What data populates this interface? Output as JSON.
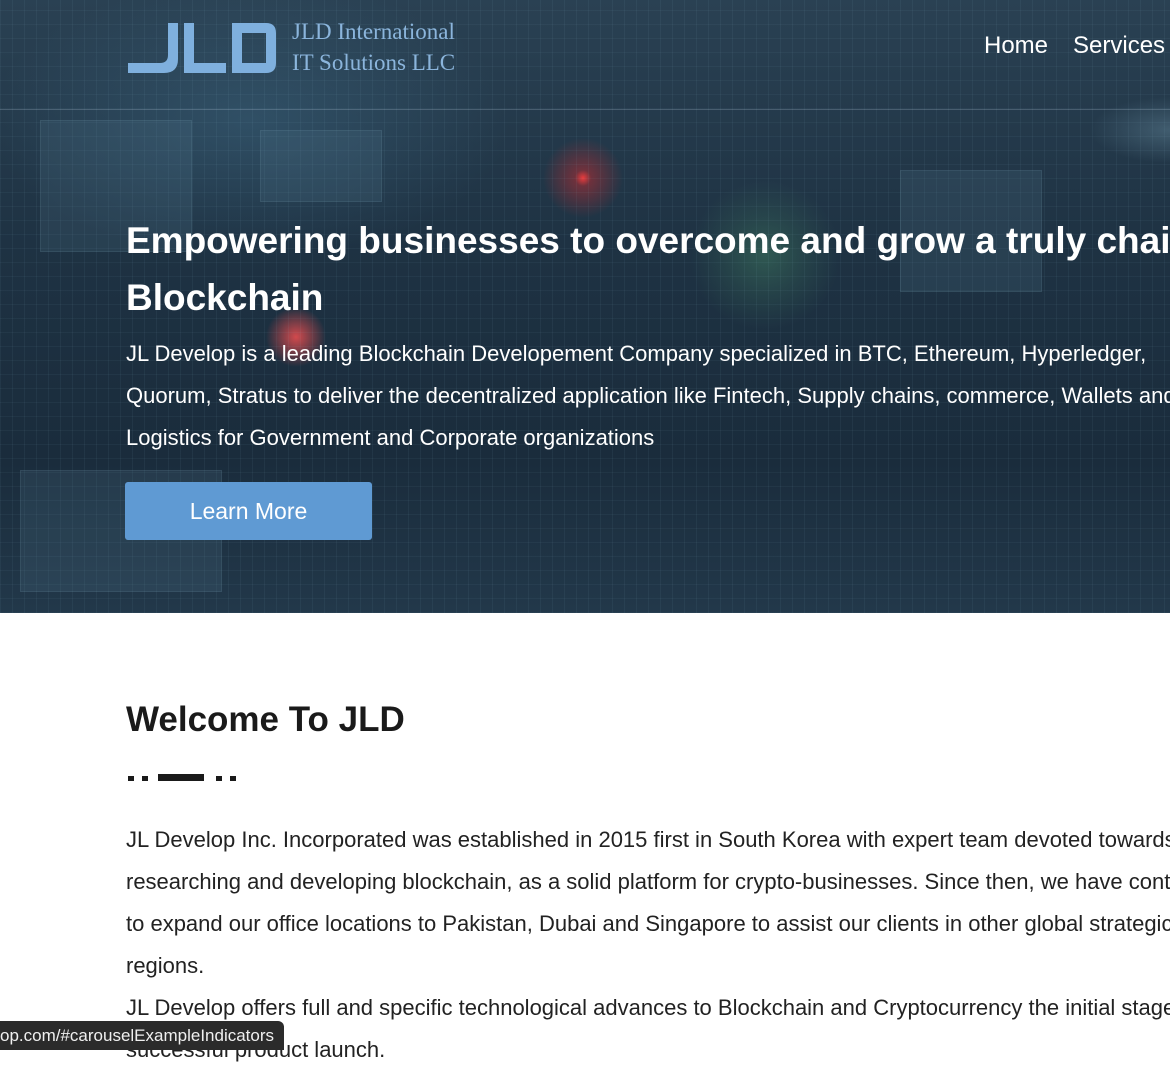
{
  "header": {
    "brand_line1": "JLD International",
    "brand_line2": "IT Solutions LLC",
    "logo_text": "JLD",
    "nav": [
      "Home",
      "Services"
    ]
  },
  "hero": {
    "title": "Empowering businesses to overcome and grow a truly chain Blockchain",
    "description": "JL Develop is a leading Blockchain Developement Company specialized in BTC, Ethereum, Hyperledger, Quorum, Stratus to deliver the decentralized application like Fintech, Supply chains, commerce, Wallets and Logistics for Government and Corporate organizations",
    "cta_label": "Learn More"
  },
  "welcome": {
    "title": "Welcome To JLD",
    "paragraph1": "JL Develop Inc. Incorporated was established in 2015 first in South Korea with expert team devoted towards researching and developing blockchain, as a solid platform for crypto-businesses. Since then, we have continued to expand our office locations to Pakistan, Dubai and Singapore to assist our clients in other global strategic regions.",
    "paragraph2": "JL Develop offers full and specific technological advances to Blockchain and Cryptocurrency the initial stage until successful product launch."
  },
  "status_bar": {
    "url": "op.com/#carouselExampleIndicators"
  },
  "colors": {
    "accent": "#5f9ad3",
    "logo": "#8bb5dc",
    "hero_bg": "#1e3243"
  }
}
